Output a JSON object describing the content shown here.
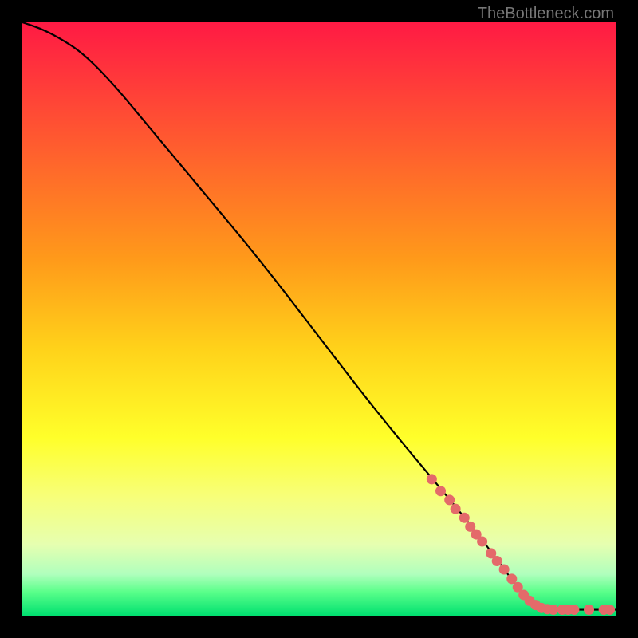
{
  "attribution": "TheBottleneck.com",
  "chart_data": {
    "type": "line",
    "title": "",
    "xlabel": "",
    "ylabel": "",
    "xlim": [
      0,
      100
    ],
    "ylim": [
      0,
      100
    ],
    "series": [
      {
        "name": "curve",
        "x": [
          0,
          3,
          6,
          10,
          15,
          20,
          30,
          40,
          50,
          60,
          70,
          75,
          80,
          84,
          86,
          88,
          90,
          92,
          94,
          96,
          98,
          100
        ],
        "y": [
          100,
          99,
          97.5,
          95,
          90,
          84,
          72,
          60,
          47,
          34,
          22,
          16,
          9.5,
          4,
          2,
          1.2,
          1,
          1,
          1,
          1,
          1,
          1
        ]
      }
    ],
    "highlight_points": [
      {
        "x": 69,
        "y": 23
      },
      {
        "x": 70.5,
        "y": 21
      },
      {
        "x": 72,
        "y": 19.5
      },
      {
        "x": 73,
        "y": 18
      },
      {
        "x": 74.5,
        "y": 16.5
      },
      {
        "x": 75.5,
        "y": 15
      },
      {
        "x": 76.5,
        "y": 13.7
      },
      {
        "x": 77.5,
        "y": 12.5
      },
      {
        "x": 79,
        "y": 10.5
      },
      {
        "x": 80,
        "y": 9.2
      },
      {
        "x": 81.2,
        "y": 7.8
      },
      {
        "x": 82.5,
        "y": 6.2
      },
      {
        "x": 83.5,
        "y": 4.8
      },
      {
        "x": 84.5,
        "y": 3.5
      },
      {
        "x": 85.5,
        "y": 2.5
      },
      {
        "x": 86.5,
        "y": 1.8
      },
      {
        "x": 87.5,
        "y": 1.3
      },
      {
        "x": 88.5,
        "y": 1.1
      },
      {
        "x": 89.5,
        "y": 1
      },
      {
        "x": 91,
        "y": 1
      },
      {
        "x": 92,
        "y": 1
      },
      {
        "x": 93,
        "y": 1
      },
      {
        "x": 95.5,
        "y": 1
      },
      {
        "x": 98,
        "y": 1
      },
      {
        "x": 99,
        "y": 1
      }
    ],
    "colors": {
      "curve": "#000000",
      "highlight": "#e46a6a"
    }
  }
}
